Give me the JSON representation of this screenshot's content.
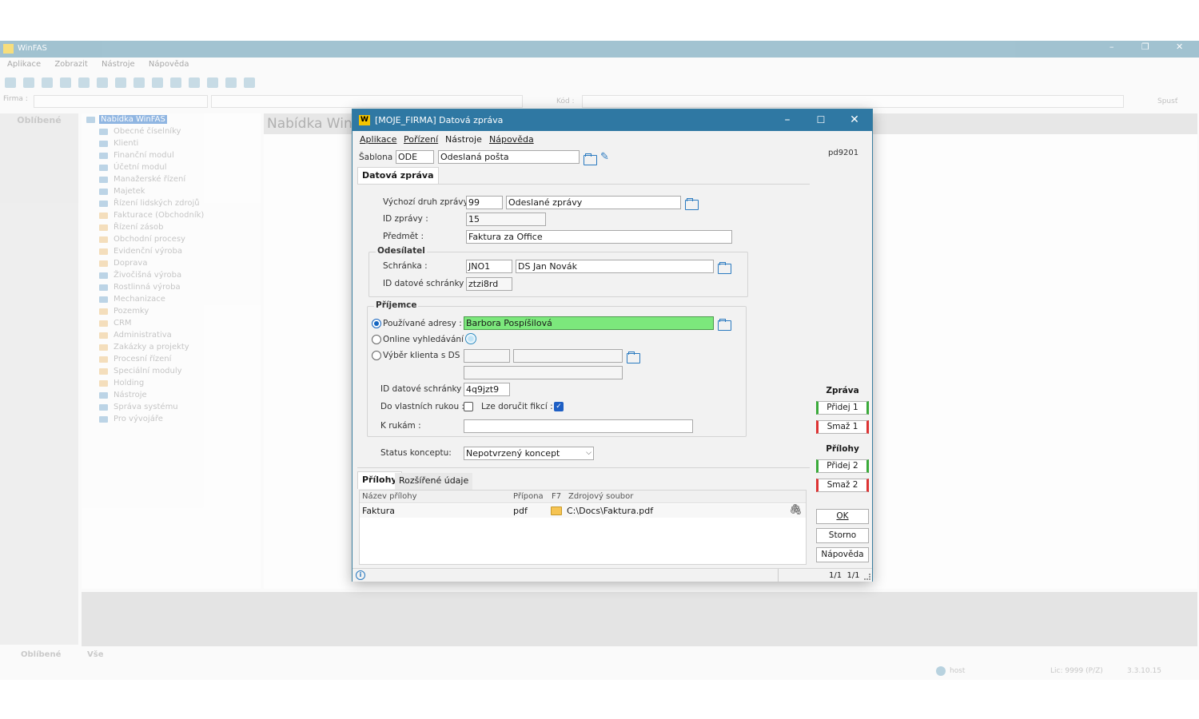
{
  "bg": {
    "app_title": "WinFAS",
    "menu": [
      "Aplikace",
      "Zobrazit",
      "Nástroje",
      "Nápověda"
    ],
    "firma_label": "Firma :",
    "kod_label": "Kód :",
    "spust": "Spusť",
    "left_tab": "Oblíbené",
    "tree_root": "Nabídka WinFAS",
    "tree": [
      "Obecné číselníky",
      "Klienti",
      "Finanční modul",
      "Účetní modul",
      "Manažerské řízení",
      "Majetek",
      "Řízení lidských zdrojů",
      "Fakturace (Obchodník)",
      "Řízení zásob",
      "Obchodní procesy",
      "Evidenční výroba",
      "Doprava",
      "Živočišná výroba",
      "Rostlinná výroba",
      "Mechanizace",
      "Pozemky",
      "CRM",
      "Administrativa",
      "Zakázky a projekty",
      "Procesní řízení",
      "Speciální moduly",
      "Holding",
      "Nástroje",
      "Správa systému",
      "Pro vývojáře"
    ],
    "center_title": "Nabídka WinFAS",
    "bottom_tabs": [
      "Oblíbené",
      "Vše"
    ],
    "status": {
      "user": "host",
      "lic": "Lic: 9999 (P/Z)",
      "version": "3.3.10.15"
    }
  },
  "dialog": {
    "title": "[MOJE_FIRMA] Datová zpráva",
    "logo": "W",
    "menu": [
      "Aplikace",
      "Pořízení",
      "Nástroje",
      "Nápověda"
    ],
    "code": "pd9201",
    "sablona_label": "Šablona :",
    "sablona_code": "ODE",
    "sablona_name": "Odeslaná pošta",
    "tab_main": "Datová zpráva",
    "vychozi_label": "Výchozí druh zprávy :",
    "vychozi_code": "99",
    "vychozi_name": "Odeslané zprávy",
    "id_zpravy_label": "ID zprávy :",
    "id_zpravy": "15",
    "predmet_label": "Předmět :",
    "predmet": "Faktura za Office",
    "odesilatel": {
      "title": "Odesílatel",
      "schranka_label": "Schránka :",
      "schranka_code": "JNO1",
      "schranka_name": "DS Jan Novák",
      "id_label": "ID datové schránky :",
      "id": "ztzi8rd"
    },
    "prijemce": {
      "title": "Příjemce",
      "opt1": "Používané adresy :",
      "opt1_value": "Barbora Pospíšilová",
      "opt2": "Online vyhledávání :",
      "opt3": "Výběr klienta s DS :",
      "id_label": "ID datové schránky :",
      "id": "4q9jzt9",
      "vlastni_label": "Do vlastních rukou :",
      "fikce_label": "Lze doručit fikcí :",
      "krukam_label": "K rukám :"
    },
    "status_label": "Status konceptu:",
    "status_value": "Nepotvrzený koncept",
    "tabs": [
      "Přílohy",
      "Rozšířené údaje"
    ],
    "grid": {
      "headers": [
        "Název přílohy",
        "Přípona",
        "F7",
        "Zdrojový soubor"
      ],
      "rows": [
        {
          "name": "Faktura",
          "ext": "pdf",
          "src": "C:\\Docs\\Faktura.pdf"
        }
      ]
    },
    "side": {
      "zprava": "Zpráva",
      "pridej1": "Přidej 1",
      "smaz1": "Smaž 1",
      "prilohy": "Přílohy",
      "pridej2": "Přidej 2",
      "smaz2": "Smaž 2",
      "ok": "OK",
      "storno": "Storno",
      "napoveda": "Nápověda"
    },
    "pager": "1/1  1/1",
    "colors": {
      "title": "#2f78a3",
      "highlight": "#7ce87c",
      "add": "#3aaa3a",
      "del": "#dd3333"
    }
  }
}
